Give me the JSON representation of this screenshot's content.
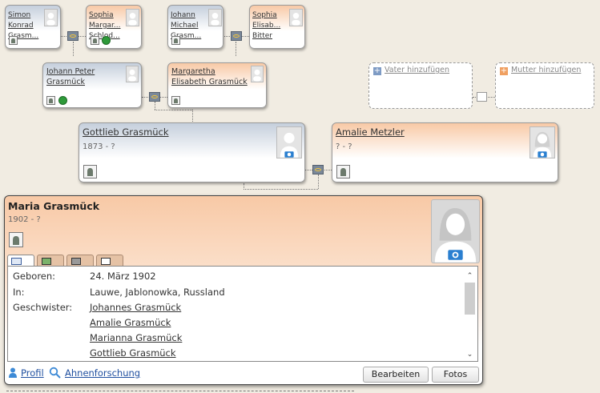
{
  "tree": {
    "gen3": [
      {
        "lines": [
          "Simon",
          "Konrad",
          "Grasm..."
        ],
        "gender": "male"
      },
      {
        "lines": [
          "Sophia",
          "Margar...",
          "Schlod..."
        ],
        "gender": "female"
      },
      {
        "lines": [
          "Johann",
          "Michael",
          "Grasm..."
        ],
        "gender": "male"
      },
      {
        "lines": [
          "Sophia",
          "Elisab...",
          "Bitter"
        ],
        "gender": "female"
      }
    ],
    "gen2": [
      {
        "lines": [
          "Johann Peter",
          "Grasmück"
        ],
        "gender": "male"
      },
      {
        "lines": [
          "Margaretha",
          "Elisabeth Grasmück"
        ],
        "gender": "female"
      }
    ],
    "add_father": "Vater hinzufügen",
    "add_mother": "Mutter hinzufügen",
    "father": {
      "name": "Gottlieb Grasmück",
      "dates": "1873 - ?"
    },
    "mother": {
      "name": "Amalie Metzler",
      "dates": "? - ?"
    }
  },
  "person": {
    "name": "Maria Grasmück",
    "dates": "1902 - ?",
    "tabs": [
      "info-tab-icon",
      "family-tab-icon",
      "places-tab-icon",
      "events-tab-icon"
    ],
    "details": [
      {
        "label": "Geboren:",
        "value": "24. März 1902",
        "link": false
      },
      {
        "label": "In:",
        "value": "Lauwe, Jablonowka, Russland",
        "link": false
      },
      {
        "label": "Geschwister:",
        "value": "Johannes Grasmück",
        "link": true
      },
      {
        "label": "",
        "value": "Amalie Grasmück",
        "link": true
      },
      {
        "label": "",
        "value": "Marianna Grasmück",
        "link": true
      },
      {
        "label": "",
        "value": "Gottlieb Grasmück",
        "link": true
      }
    ],
    "footer": {
      "profile": "Profil",
      "research": "Ahnenforschung",
      "edit": "Bearbeiten",
      "photos": "Fotos"
    }
  },
  "colors": {
    "male": "#c5cfdc",
    "female": "#f8c9a6",
    "background": "#f1ece2"
  }
}
